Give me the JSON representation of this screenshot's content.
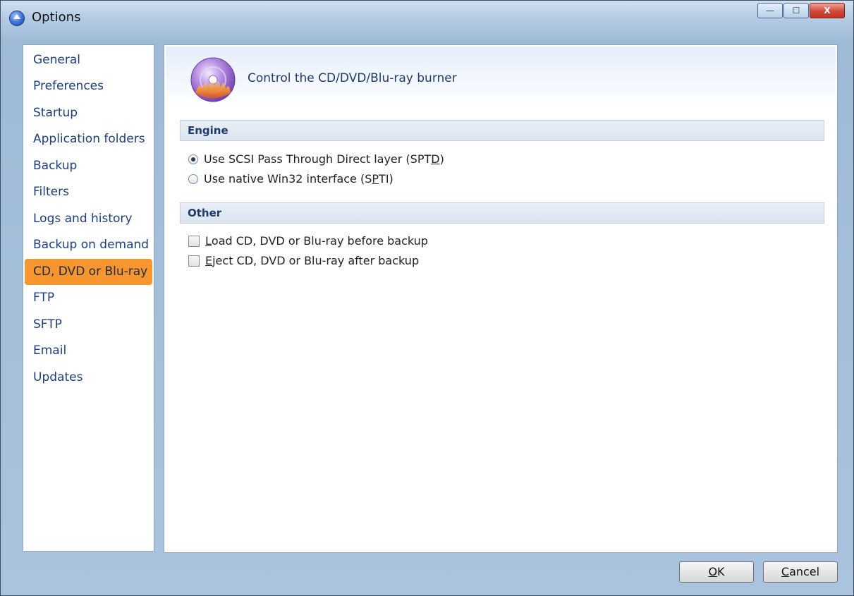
{
  "window": {
    "title": "Options",
    "controls": {
      "minimize": "—",
      "maximize": "☐",
      "close": "X"
    }
  },
  "sidebar": {
    "items": [
      {
        "label": "General"
      },
      {
        "label": "Preferences"
      },
      {
        "label": "Startup"
      },
      {
        "label": "Application folders"
      },
      {
        "label": "Backup"
      },
      {
        "label": "Filters"
      },
      {
        "label": "Logs and history"
      },
      {
        "label": "Backup on demand"
      },
      {
        "label": "CD, DVD or Blu-ray",
        "selected": true
      },
      {
        "label": "FTP"
      },
      {
        "label": "SFTP"
      },
      {
        "label": "Email"
      },
      {
        "label": "Updates"
      }
    ],
    "selected_color": "#f7952e"
  },
  "content": {
    "header_icon": "disc-burner-icon",
    "header_text": "Control the CD/DVD/Blu-ray burner",
    "engine": {
      "title": "Engine",
      "opt1": {
        "pre": "Use SCSI Pass Through Direct layer (SPT",
        "u": "D",
        "post": ")",
        "checked": true
      },
      "opt2": {
        "pre": "Use native Win32 interface (S",
        "u": "P",
        "post": "TI)",
        "checked": false
      }
    },
    "other": {
      "title": "Other",
      "opt1": {
        "u": "L",
        "rest": "oad CD, DVD or Blu-ray before backup",
        "checked": false
      },
      "opt2": {
        "u": "E",
        "rest": "ject CD, DVD or Blu-ray after backup",
        "checked": false
      }
    }
  },
  "footer": {
    "ok": {
      "u": "O",
      "rest": "K"
    },
    "cancel": {
      "u": "C",
      "rest": "ancel"
    }
  }
}
